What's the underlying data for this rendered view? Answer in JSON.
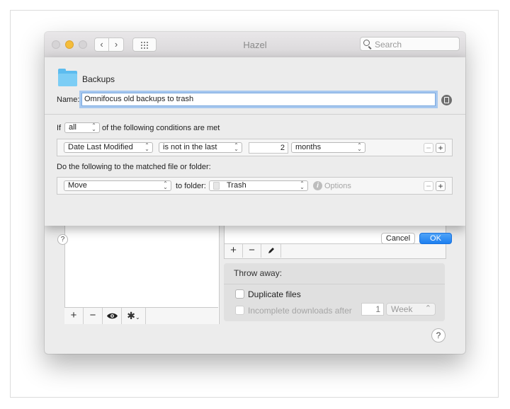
{
  "window": {
    "title": "Hazel",
    "search_placeholder": "Search"
  },
  "sheet": {
    "folder_name": "Backups",
    "name_label": "Name:",
    "rule_name": "Omnifocus old backups to trash",
    "if_label": "If",
    "match_mode": "all",
    "conditions_suffix": "of the following conditions are met",
    "condition": {
      "attribute": "Date Last Modified",
      "operator": "is not in the last",
      "amount": "2",
      "unit": "months"
    },
    "actions_label": "Do the following to the matched file or folder:",
    "action": {
      "verb": "Move",
      "to_folder_label": "to folder:",
      "folder": "Trash",
      "options_label": "Options"
    },
    "help_label": "?",
    "cancel_label": "Cancel",
    "ok_label": "OK"
  },
  "background": {
    "folders_toolbar": {
      "add": "+",
      "remove": "−"
    },
    "rules_toolbar": {
      "add": "+",
      "remove": "−"
    },
    "throw_away": {
      "title": "Throw away:",
      "duplicates_label": "Duplicate files",
      "incomplete_label": "Incomplete downloads after",
      "incomplete_amount": "1",
      "incomplete_unit": "Week"
    },
    "help_label": "?"
  },
  "colors": {
    "accent": "#1d7ff0",
    "folder": "#5cbcef",
    "focus_ring": "#a7c8ef",
    "minimize": "#f5bd3a"
  },
  "icons": [
    "search-icon",
    "folder-icon",
    "info-icon",
    "eye-icon",
    "gear-icon",
    "pencil-icon",
    "trash-icon",
    "options-icon"
  ]
}
